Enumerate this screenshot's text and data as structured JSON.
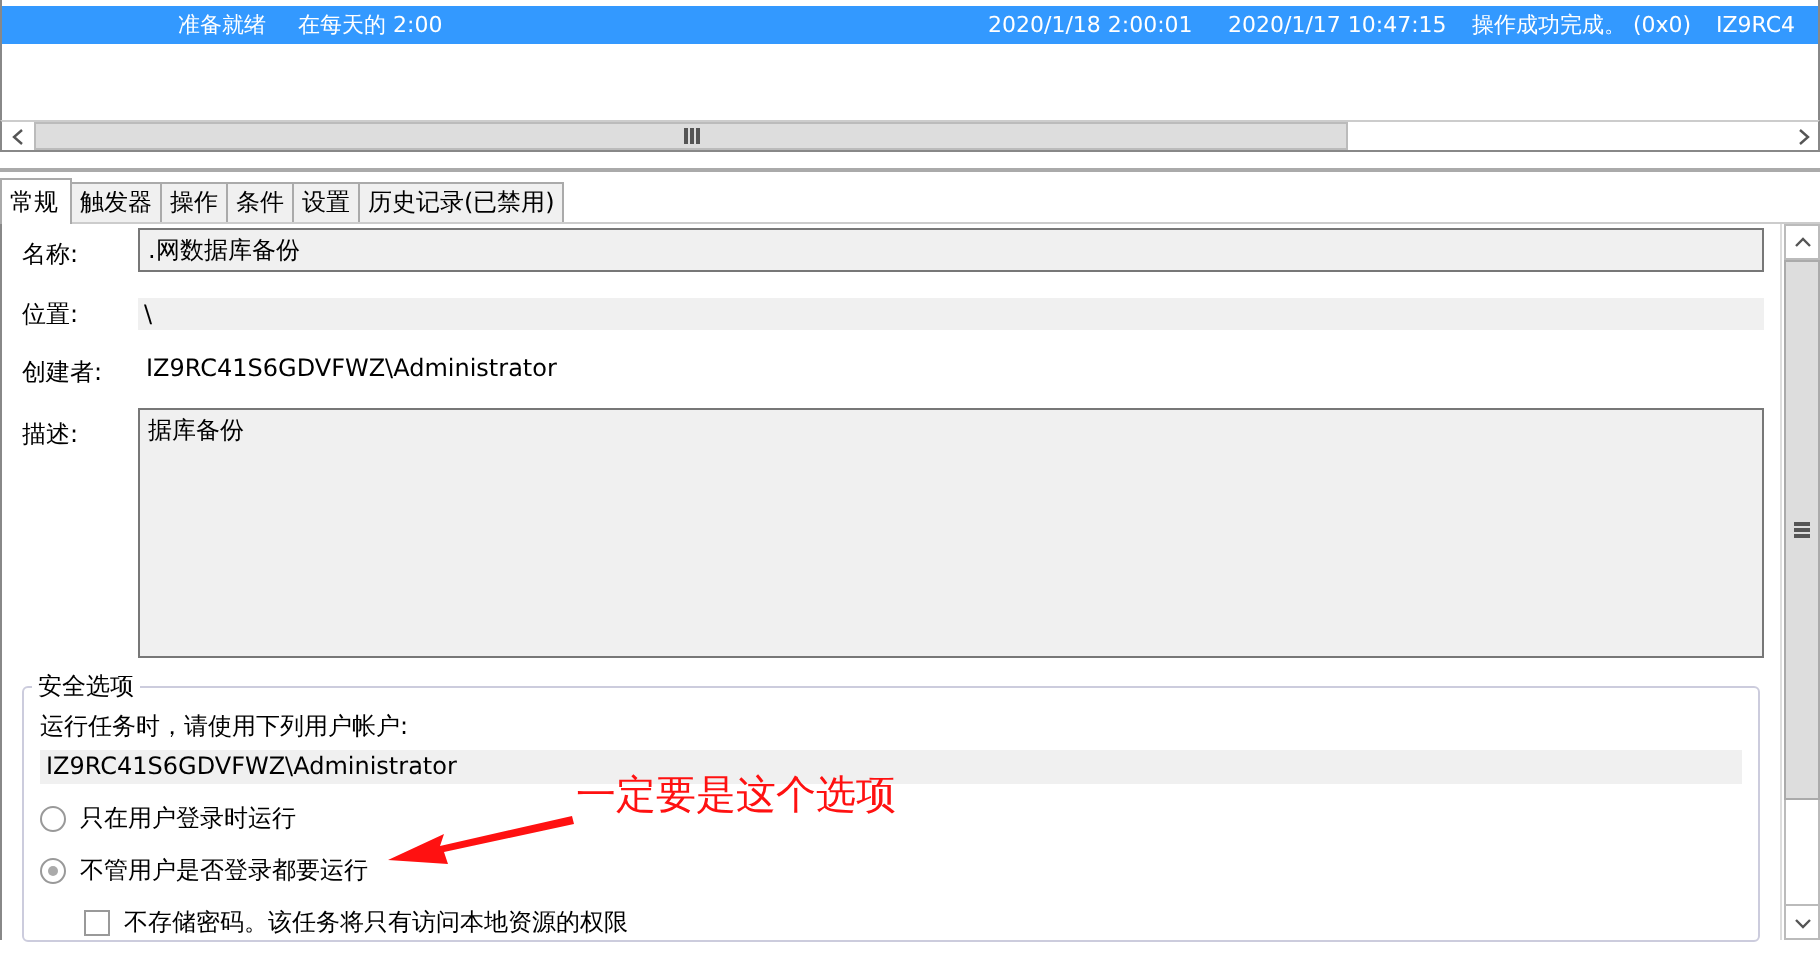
{
  "task_list": {
    "rows": [
      {
        "selected": true,
        "cells": [
          "准备就绪",
          "在每天的 2:00",
          "2020/1/18 2:00:01",
          "2020/1/17 10:47:15",
          "操作成功完成。 (0x0)",
          "IZ9RC4"
        ]
      }
    ]
  },
  "tabs": [
    {
      "label": "常规",
      "selected": true
    },
    {
      "label": "触发器",
      "selected": false
    },
    {
      "label": "操作",
      "selected": false
    },
    {
      "label": "条件",
      "selected": false
    },
    {
      "label": "设置",
      "selected": false
    },
    {
      "label": "历史记录(已禁用)",
      "selected": false
    }
  ],
  "general": {
    "fields": [
      {
        "kind": "box",
        "label": "名称:",
        "value": ".网数据库备份"
      },
      {
        "kind": "flat",
        "label": "位置:",
        "value": "\\"
      },
      {
        "kind": "plain",
        "label": "创建者:",
        "value": "IZ9RC41S6GDVFWZ\\Administrator"
      },
      {
        "kind": "area",
        "label": "描述:",
        "value": "据库备份"
      }
    ],
    "security": {
      "title": "安全选项",
      "prompt": "运行任务时，请使用下列用户帐户:",
      "account": "IZ9RC41S6GDVFWZ\\Administrator",
      "options": [
        {
          "kind": "radio",
          "label": "只在用户登录时运行",
          "selected": false
        },
        {
          "kind": "radio",
          "label": "不管用户是否登录都要运行",
          "selected": true
        },
        {
          "kind": "checkbox",
          "label": "不存储密码。该任务将只有访问本地资源的权限",
          "checked": false
        }
      ]
    }
  },
  "annotation": {
    "text": "一定要是这个选项"
  }
}
